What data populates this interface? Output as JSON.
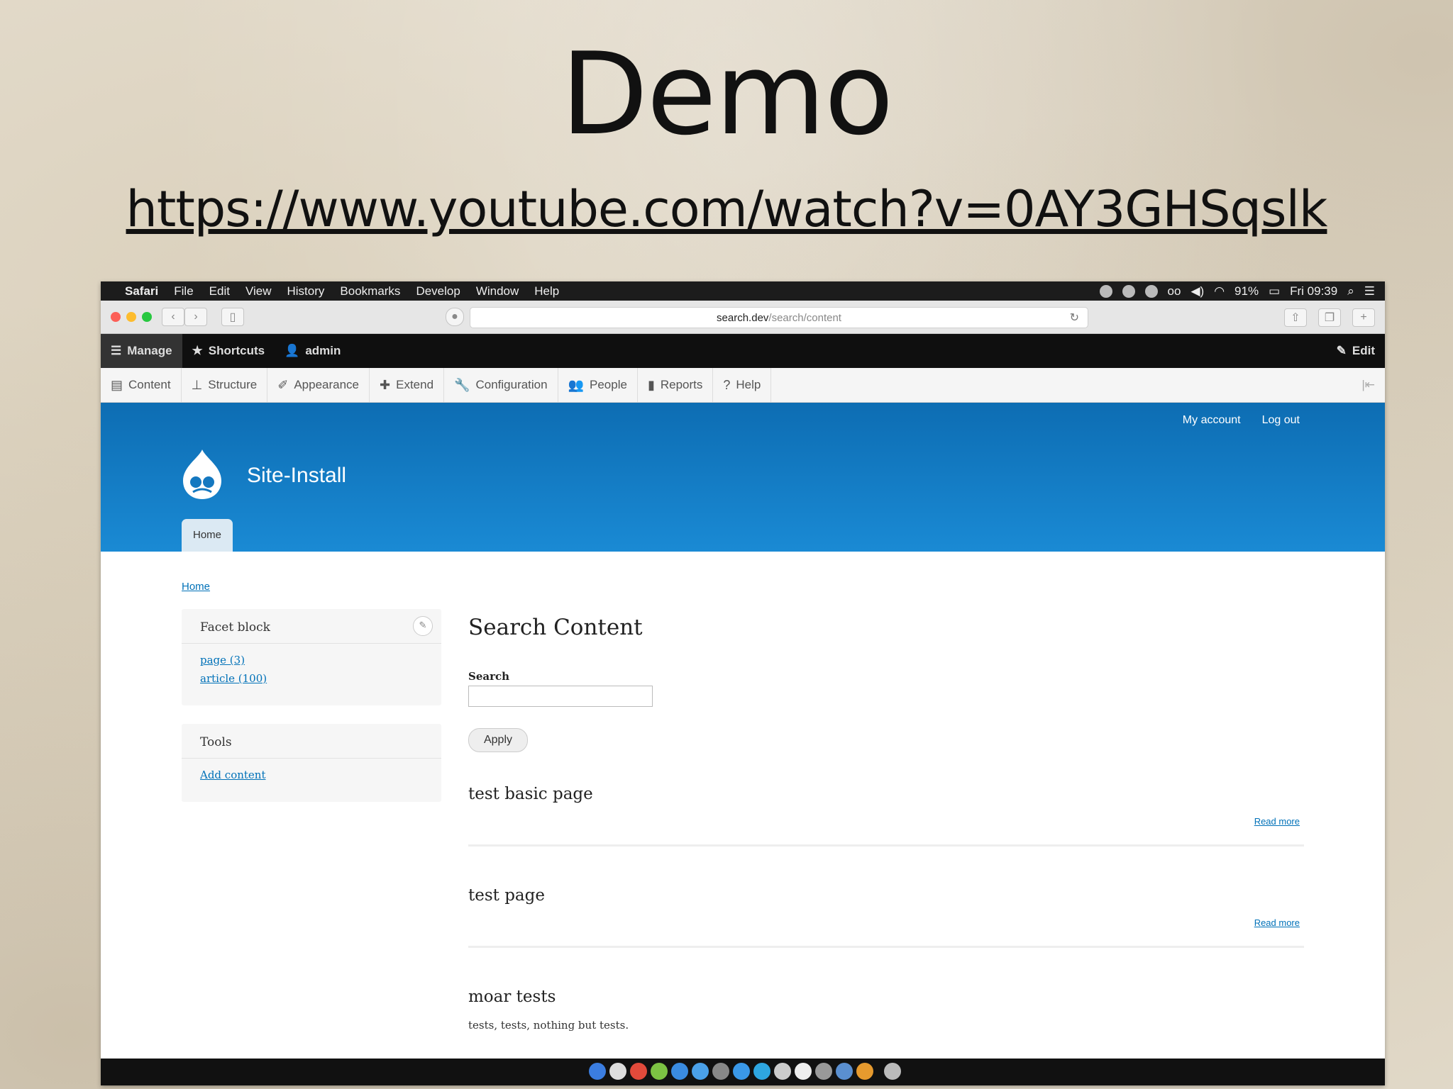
{
  "slide": {
    "title": "Demo",
    "url": "https://www.youtube.com/watch?v=0AY3GHSqslk"
  },
  "menubar": {
    "items": [
      "Safari",
      "File",
      "Edit",
      "View",
      "History",
      "Bookmarks",
      "Develop",
      "Window",
      "Help"
    ],
    "battery": "91%",
    "clock": "Fri 09:39"
  },
  "browser": {
    "address_host": "search.dev",
    "address_path": "/search/content"
  },
  "drupal_toolbar": {
    "manage": "Manage",
    "shortcuts": "Shortcuts",
    "user": "admin",
    "edit": "Edit"
  },
  "admin_tray": {
    "items": [
      "Content",
      "Structure",
      "Appearance",
      "Extend",
      "Configuration",
      "People",
      "Reports",
      "Help"
    ]
  },
  "header": {
    "my_account": "My account",
    "log_out": "Log out",
    "site_name": "Site-Install",
    "tab_home": "Home"
  },
  "breadcrumb": "Home",
  "facet_block": {
    "title": "Facet block",
    "links": [
      "page (3)",
      "article (100)"
    ]
  },
  "tools_block": {
    "title": "Tools",
    "link": "Add content"
  },
  "main": {
    "title": "Search Content",
    "search_label": "Search",
    "search_value": "",
    "apply_label": "Apply",
    "results": [
      {
        "title": "test basic page",
        "read_more": "Read more"
      },
      {
        "title": "test page",
        "read_more": "Read more"
      },
      {
        "title": "moar tests",
        "snippet": "tests, tests, nothing but tests."
      }
    ]
  },
  "colors": {
    "header_blue": "#1a8ad4",
    "link_blue": "#0071b8",
    "toolbar_black": "#0f0f0f"
  }
}
